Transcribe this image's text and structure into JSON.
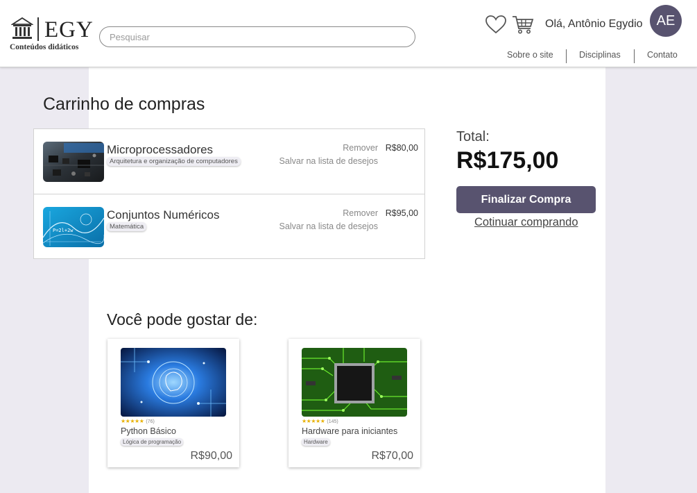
{
  "header": {
    "logo_text": "EGY",
    "logo_subtitle": "Conteúdos didáticos",
    "search_placeholder": "Pesquisar",
    "greeting": "Olá, Antônio Egydio",
    "avatar_initials": "AE",
    "nav": [
      "Sobre o site",
      "Disciplinas",
      "Contato"
    ],
    "icons": [
      "building-logo-icon",
      "heart-icon",
      "cart-icon"
    ]
  },
  "cart": {
    "title": "Carrinho de compras",
    "items": [
      {
        "name": "Microprocessadores",
        "tag": "Arquitetura e organização de computadores",
        "remove": "Remover",
        "wishlist": "Salvar na lista de desejos",
        "price": "R$80,00"
      },
      {
        "name": "Conjuntos Numéricos",
        "tag": "Matemática",
        "remove": "Remover",
        "wishlist": "Salvar na lista de desejos",
        "price": "R$95,00"
      }
    ]
  },
  "summary": {
    "total_label": "Total:",
    "total_value": "R$175,00",
    "finish_button": "Finalizar Compra",
    "continue_link": "Cotinuar comprando"
  },
  "suggestions": {
    "title": "Você pode gostar de:",
    "items": [
      {
        "stars": "★★★★★",
        "rating": 4.5,
        "reviews": "(76)",
        "name": "Python Básico",
        "tag": "Lógica de programação",
        "price": "R$90,00"
      },
      {
        "stars": "★★★★★",
        "rating": 5,
        "reviews": "(145)",
        "name": "Hardware para iniciantes",
        "tag": "Hardware",
        "price": "R$70,00"
      }
    ]
  },
  "colors": {
    "accent": "#58536f",
    "background": "#eceaf1",
    "star": "#e8b106"
  }
}
